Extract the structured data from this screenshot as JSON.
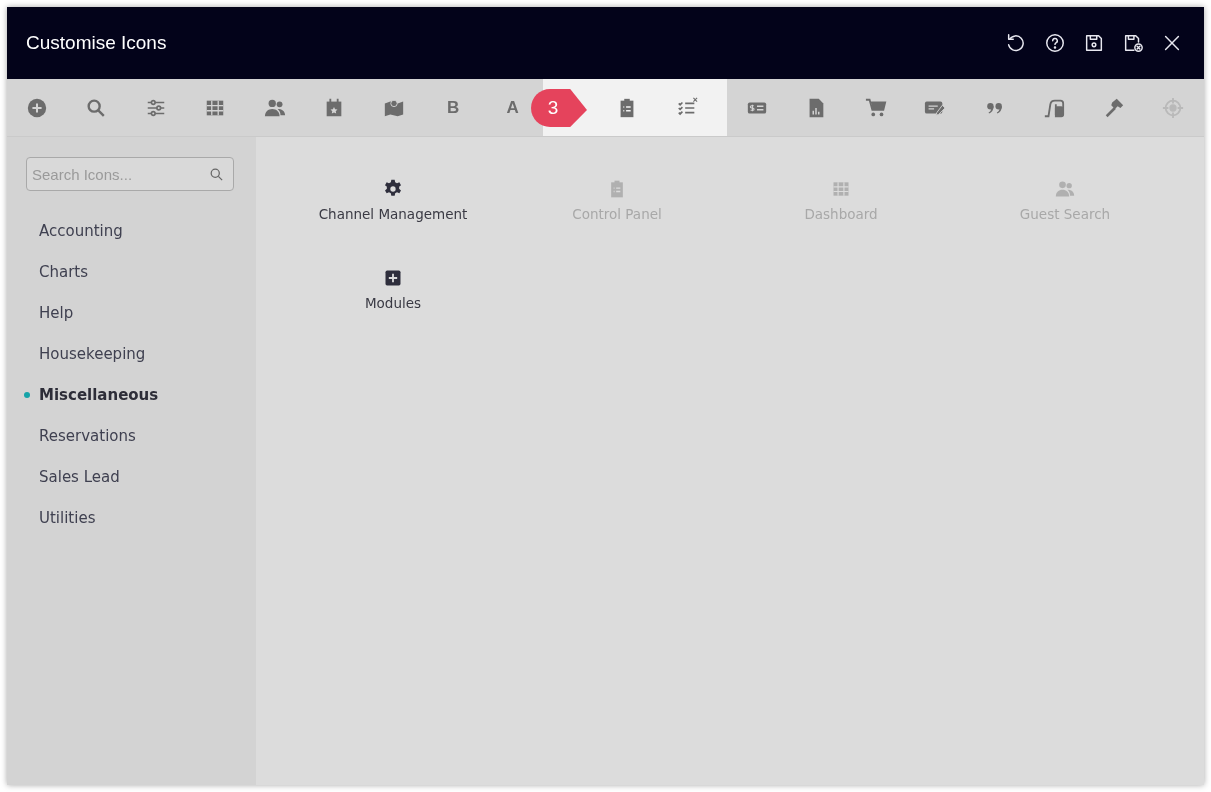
{
  "window": {
    "title": "Customise Icons",
    "actions": [
      {
        "kind": "undo"
      },
      {
        "kind": "help"
      },
      {
        "kind": "save"
      },
      {
        "kind": "save-cancel"
      },
      {
        "kind": "close"
      }
    ]
  },
  "toolbar": {
    "step": "3",
    "items": [
      {
        "kind": "plus-circle",
        "spotlight": false,
        "disabled": false
      },
      {
        "kind": "search",
        "spotlight": false,
        "disabled": false
      },
      {
        "kind": "sliders",
        "spotlight": false,
        "disabled": false
      },
      {
        "kind": "grid",
        "spotlight": false,
        "disabled": false
      },
      {
        "kind": "users",
        "spotlight": false,
        "disabled": false
      },
      {
        "kind": "calendar",
        "spotlight": false,
        "disabled": false
      },
      {
        "kind": "map",
        "spotlight": false,
        "disabled": false
      },
      {
        "kind": "text",
        "label": "B",
        "spotlight": false,
        "disabled": false
      },
      {
        "kind": "text",
        "label": "A",
        "spotlight": false,
        "disabled": false
      },
      {
        "kind": "clipboard",
        "spotlight": true,
        "disabled": false
      },
      {
        "kind": "checklist",
        "spotlight": true,
        "disabled": false
      },
      {
        "kind": "money",
        "spotlight": false,
        "disabled": false
      },
      {
        "kind": "report",
        "spotlight": false,
        "disabled": false
      },
      {
        "kind": "cart",
        "spotlight": false,
        "disabled": false
      },
      {
        "kind": "edit",
        "spotlight": false,
        "disabled": false
      },
      {
        "kind": "quote",
        "spotlight": false,
        "disabled": false
      },
      {
        "kind": "vacuum",
        "spotlight": false,
        "disabled": false
      },
      {
        "kind": "hammer",
        "spotlight": false,
        "disabled": false
      },
      {
        "kind": "crosshair",
        "spotlight": false,
        "disabled": true
      }
    ]
  },
  "sidebar": {
    "search": {
      "placeholder": "Search Icons..."
    },
    "items": [
      {
        "label": "Accounting",
        "selected": false
      },
      {
        "label": "Charts",
        "selected": false
      },
      {
        "label": "Help",
        "selected": false
      },
      {
        "label": "Housekeeping",
        "selected": false
      },
      {
        "label": "Miscellaneous",
        "selected": true
      },
      {
        "label": "Reservations",
        "selected": false
      },
      {
        "label": "Sales Lead",
        "selected": false
      },
      {
        "label": "Utilities",
        "selected": false
      }
    ]
  },
  "icons": [
    {
      "kind": "gear",
      "label": "Channel Management",
      "disabled": false
    },
    {
      "kind": "clipboard",
      "label": "Control Panel",
      "disabled": true
    },
    {
      "kind": "grid",
      "label": "Dashboard",
      "disabled": true
    },
    {
      "kind": "users",
      "label": "Guest Search",
      "disabled": true
    },
    {
      "kind": "plus-square",
      "label": "Modules",
      "disabled": false
    }
  ]
}
